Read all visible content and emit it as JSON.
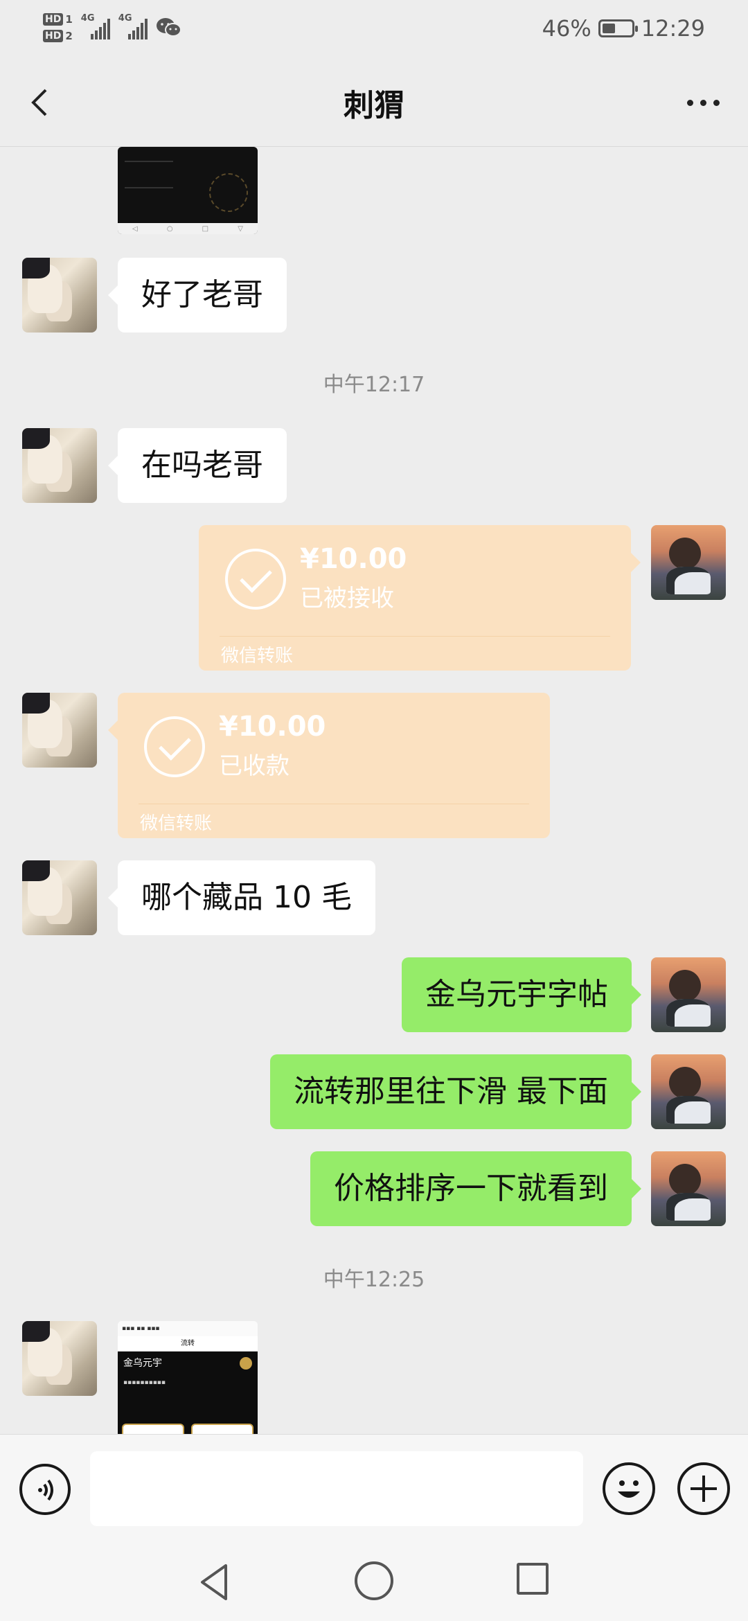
{
  "status_bar": {
    "hd1": "HD",
    "hd1_num": "1",
    "hd2": "HD",
    "hd2_num": "2",
    "net1": "4G",
    "net2": "4G",
    "battery_percent": "46%",
    "battery_level": 0.46,
    "time": "12:29",
    "icons": [
      "signal-icon",
      "wechat-icon",
      "battery-icon"
    ]
  },
  "header": {
    "title": "刺猬",
    "back_icon": "chevron-left-icon",
    "more_icon": "more-dots-icon"
  },
  "messages": [
    {
      "type": "image",
      "side": "in",
      "desc_icon": "screenshot-thumbnail"
    },
    {
      "type": "text",
      "side": "in",
      "text": "好了老哥"
    },
    {
      "type": "time",
      "text": "中午12:17"
    },
    {
      "type": "text",
      "side": "in",
      "text": "在吗老哥"
    },
    {
      "type": "transfer",
      "side": "out",
      "amount": "¥10.00",
      "status": "已被接收",
      "footer": "微信转账"
    },
    {
      "type": "transfer",
      "side": "in",
      "amount": "¥10.00",
      "status": "已收款",
      "footer": "微信转账"
    },
    {
      "type": "text",
      "side": "in",
      "text": "哪个藏品 10 毛"
    },
    {
      "type": "text",
      "side": "out",
      "text": "金乌元宇字帖"
    },
    {
      "type": "text",
      "side": "out",
      "text": "流转那里往下滑 最下面"
    },
    {
      "type": "text",
      "side": "out",
      "text": "价格排序一下就看到"
    },
    {
      "type": "time",
      "text": "中午12:25"
    },
    {
      "type": "image",
      "side": "in",
      "thumb_title": "金乌元宇",
      "thumb_header": "流转"
    }
  ],
  "input_bar": {
    "voice_icon": "voice-icon",
    "emoji_icon": "emoji-icon",
    "plus_icon": "plus-icon",
    "value": ""
  },
  "nav_bar": {
    "icons": [
      "back-triangle-icon",
      "home-circle-icon",
      "recent-square-icon"
    ]
  },
  "colors": {
    "background": "#ededed",
    "outgoing_bubble": "#95ec69",
    "incoming_bubble": "#ffffff",
    "transfer_bubble": "#fbe1c1"
  }
}
